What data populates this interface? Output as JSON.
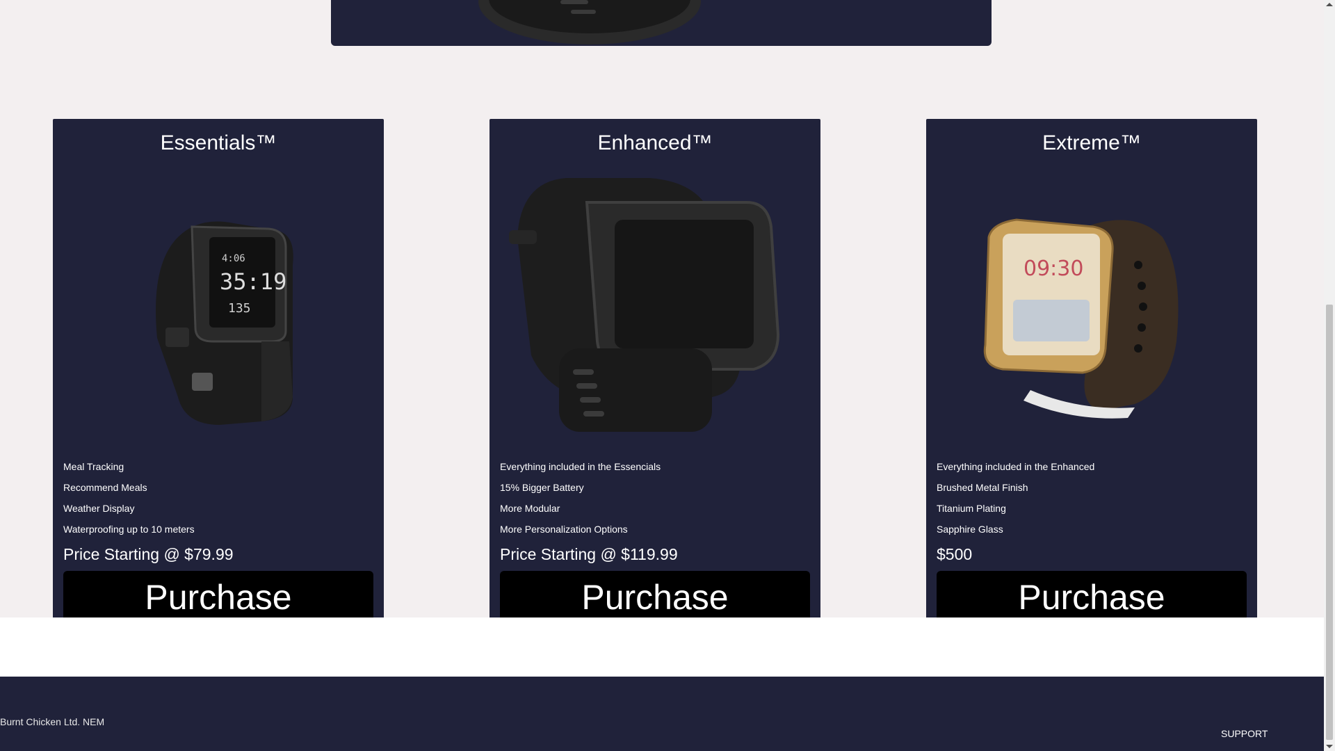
{
  "top_banner": {
    "image_icon": "smartwatch-icon"
  },
  "plans": [
    {
      "title": "Essentials™",
      "image_icon": "smartwatch-icon",
      "features": [
        "Meal Tracking",
        "Recommend Meals",
        "Weather Display",
        "Waterproofing up to 10 meters"
      ],
      "price": "Price Starting @ $79.99",
      "button_label": "Purchase"
    },
    {
      "title": "Enhanced™",
      "image_icon": "smartwatch-icon",
      "features": [
        "Everything included in the Essencials",
        "15% Bigger Battery",
        "More Modular",
        "More Personalization Options"
      ],
      "price": "Price Starting @ $119.99",
      "button_label": "Purchase"
    },
    {
      "title": "Extreme™",
      "image_icon": "smartwatch-icon",
      "features": [
        "Everything included in the Enhanced",
        "Brushed Metal Finish",
        "Titanium Plating",
        "Sapphire Glass"
      ],
      "price": "$500",
      "button_label": "Purchase"
    }
  ],
  "footer": {
    "company": "Burnt Chicken Ltd. NEM",
    "support_link": "SUPPORT"
  },
  "colors": {
    "page_bg": "#f3eff0",
    "card_bg": "#20223a",
    "button_bg": "#000000",
    "text": "#ffffff"
  }
}
